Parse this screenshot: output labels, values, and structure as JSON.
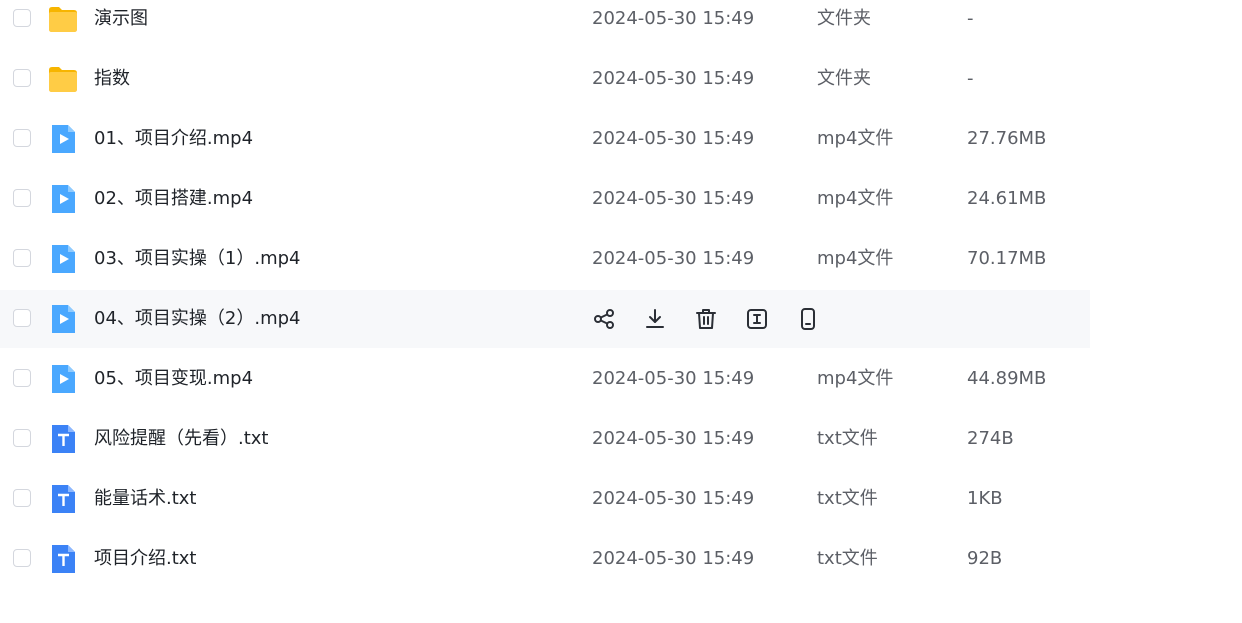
{
  "files": [
    {
      "name": "演示图",
      "modified": "2024-05-30 15:49",
      "type": "文件夹",
      "size": "-",
      "icon": "folder-icon"
    },
    {
      "name": "指数",
      "modified": "2024-05-30 15:49",
      "type": "文件夹",
      "size": "-",
      "icon": "folder-icon"
    },
    {
      "name": "01、项目介绍.mp4",
      "modified": "2024-05-30 15:49",
      "type": "mp4文件",
      "size": "27.76MB",
      "icon": "video-file-icon"
    },
    {
      "name": "02、项目搭建.mp4",
      "modified": "2024-05-30 15:49",
      "type": "mp4文件",
      "size": "24.61MB",
      "icon": "video-file-icon"
    },
    {
      "name": "03、项目实操（1）.mp4",
      "modified": "2024-05-30 15:49",
      "type": "mp4文件",
      "size": "70.17MB",
      "icon": "video-file-icon"
    },
    {
      "name": "04、项目实操（2）.mp4",
      "icon": "video-file-icon",
      "hovered": true
    },
    {
      "name": "05、项目变现.mp4",
      "modified": "2024-05-30 15:49",
      "type": "mp4文件",
      "size": "44.89MB",
      "icon": "video-file-icon"
    },
    {
      "name": "风险提醒（先看）.txt",
      "modified": "2024-05-30 15:49",
      "type": "txt文件",
      "size": "274B",
      "icon": "text-file-icon"
    },
    {
      "name": "能量话术.txt",
      "modified": "2024-05-30 15:49",
      "type": "txt文件",
      "size": "1KB",
      "icon": "text-file-icon"
    },
    {
      "name": "项目介绍.txt",
      "modified": "2024-05-30 15:49",
      "type": "txt文件",
      "size": "92B",
      "icon": "text-file-icon"
    }
  ],
  "hover_actions": [
    "share-icon",
    "download-icon",
    "delete-icon",
    "rename-icon",
    "mobile-icon"
  ],
  "colors": {
    "folder": "#ffc93d",
    "video": "#4aa8ff",
    "text_file": "#3b82f6",
    "hover_row": "#f7f8fa",
    "text_primary": "#1f2329",
    "text_secondary": "#5c5f66"
  }
}
